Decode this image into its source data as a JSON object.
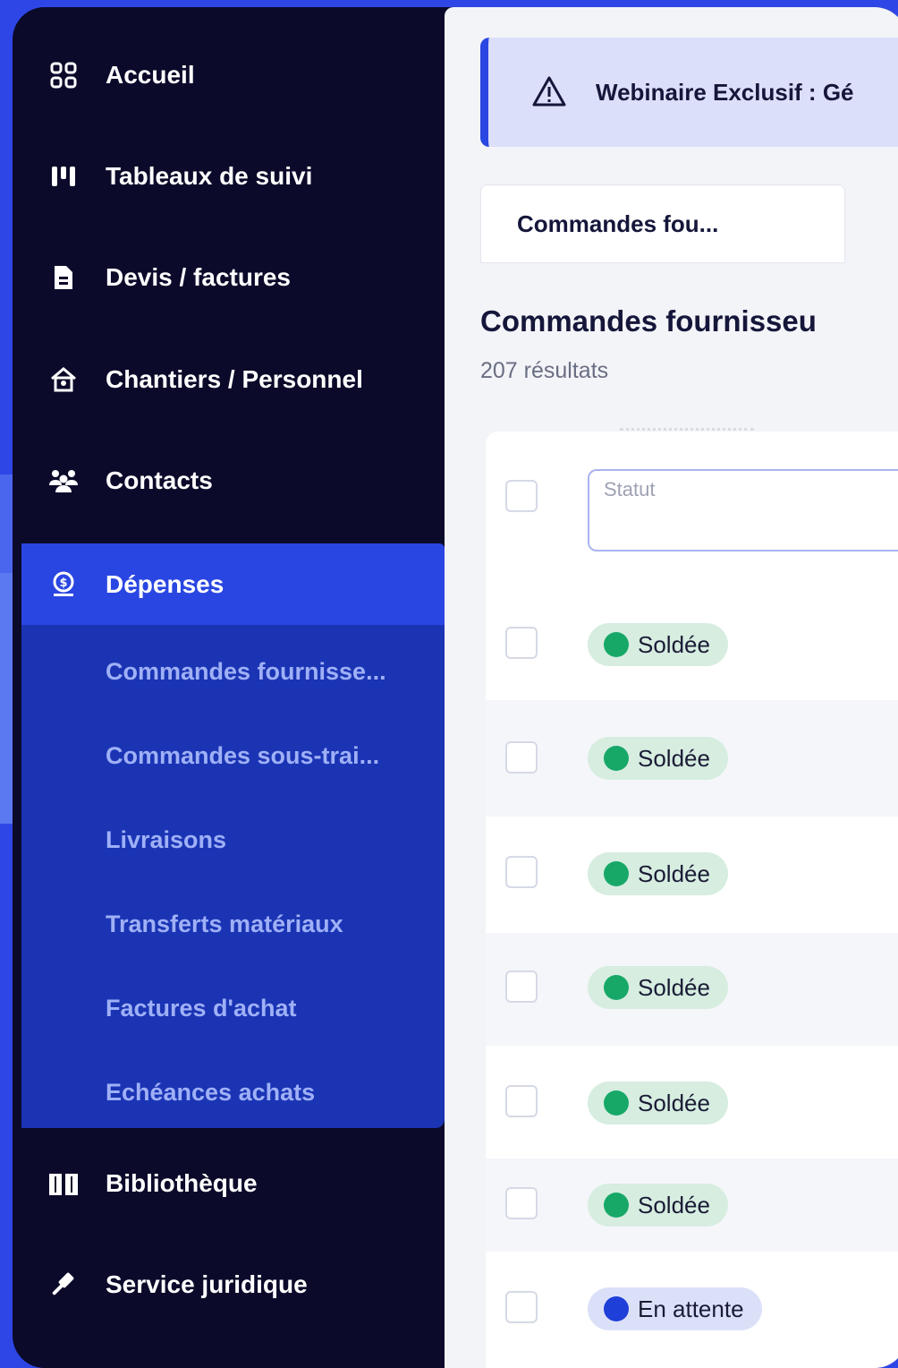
{
  "sidebar": {
    "items": [
      {
        "label": "Accueil",
        "icon": "dashboard-icon"
      },
      {
        "label": "Tableaux de suivi",
        "icon": "chart-board-icon"
      },
      {
        "label": "Devis / factures",
        "icon": "document-icon"
      },
      {
        "label": "Chantiers / Personnel",
        "icon": "house-icon"
      },
      {
        "label": "Contacts",
        "icon": "people-icon"
      },
      {
        "label": "Dépenses",
        "icon": "money-icon",
        "active": true
      },
      {
        "label": "Bibliothèque",
        "icon": "book-icon"
      },
      {
        "label": "Service juridique",
        "icon": "gavel-icon"
      }
    ],
    "submenu": [
      "Commandes fournisse...",
      "Commandes sous-trai...",
      "Livraisons",
      "Transferts matériaux",
      "Factures d'achat",
      "Echéances achats"
    ]
  },
  "banner": {
    "text": "Webinaire Exclusif : Gé",
    "icon": "warning-icon"
  },
  "tab": {
    "label": "Commandes fou..."
  },
  "page": {
    "title": "Commandes fournisseu",
    "results": "207 résultats"
  },
  "table": {
    "filter_placeholder": "Statut",
    "rows": [
      {
        "status": "Soldée",
        "color": "#17a868"
      },
      {
        "status": "Soldée",
        "color": "#17a868"
      },
      {
        "status": "Soldée",
        "color": "#17a868"
      },
      {
        "status": "Soldée",
        "color": "#17a868"
      },
      {
        "status": "Soldée",
        "color": "#17a868"
      },
      {
        "status": "Soldée",
        "color": "#17a868"
      },
      {
        "status": "En attente",
        "color": "#1e3fd8"
      }
    ]
  },
  "colors": {
    "sidebar_bg": "#0b0a2a",
    "accent": "#2a46e2",
    "submenu_bg": "#1a34b4",
    "status_done": "#17a868",
    "status_pending": "#1e3fd8"
  }
}
